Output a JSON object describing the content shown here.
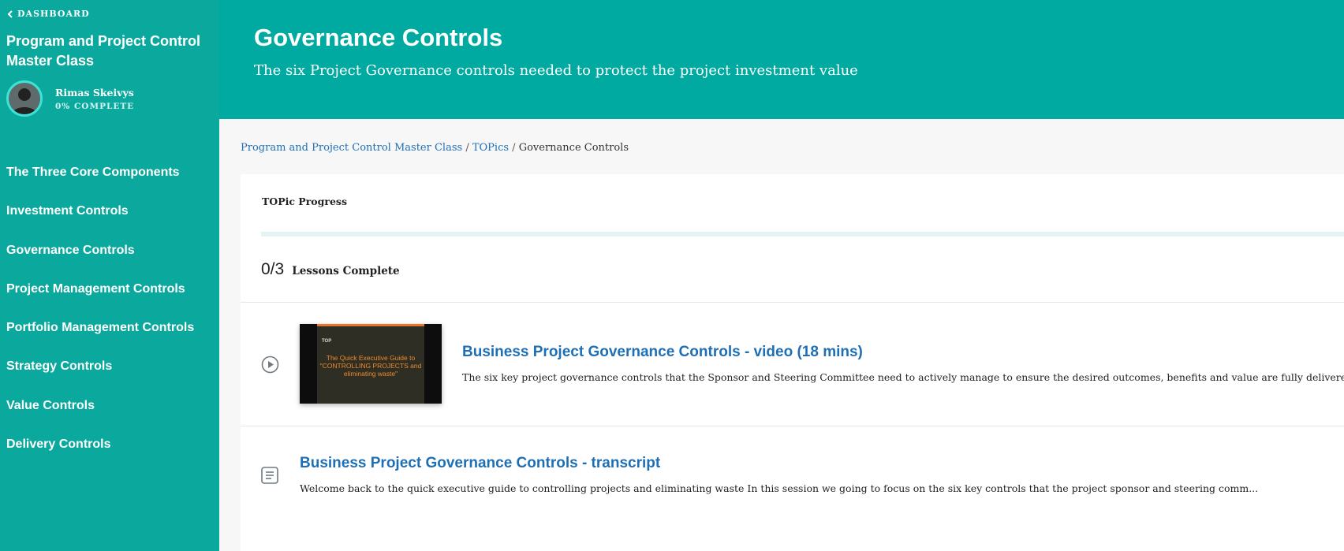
{
  "sidebar": {
    "back_label": "DASHBOARD",
    "course_title": "Program and Project Control Master Class",
    "user_name": "Rimas Skeivys",
    "progress_text": "0% COMPLETE",
    "items": [
      {
        "label": "The Three Core Components"
      },
      {
        "label": "Investment Controls"
      },
      {
        "label": "Governance Controls"
      },
      {
        "label": "Project Management Controls"
      },
      {
        "label": "Portfolio Management Controls"
      },
      {
        "label": "Strategy Controls"
      },
      {
        "label": "Value Controls"
      },
      {
        "label": "Delivery Controls"
      }
    ]
  },
  "header": {
    "title": "Governance Controls",
    "subtitle": "The six Project Governance controls needed to protect the project investment value"
  },
  "breadcrumb": {
    "course": "Program and Project Control Master Class",
    "topics": "TOPics",
    "current": "Governance Controls",
    "separator": "/"
  },
  "progress": {
    "label": "TOPic Progress",
    "fraction": 0,
    "count": "0/3",
    "lessons_label": "Lessons Complete"
  },
  "lessons": [
    {
      "icon": "play-circle-icon",
      "thumbnail_logo": "TOP",
      "thumbnail_text": "The Quick Executive Guide to \"CONTROLLING PROJECTS and eliminating waste\"",
      "title": "Business Project Governance Controls - video (18 mins)",
      "description": "The six key project governance controls that the Sponsor and Steering Committee need to actively manage to ensure the desired outcomes, benefits and value are fully delivered."
    },
    {
      "icon": "document-icon",
      "title": "Business Project Governance Controls - transcript",
      "description": "Welcome back to the quick executive guide to controlling projects and eliminating waste   In this session we going to focus on the six key controls that the project sponsor and steering comm..."
    }
  ],
  "colors": {
    "sidebar_bg": "#0ba89e",
    "header_bg": "#00aaa1",
    "link": "#1f6fb5",
    "thumbnail_accent": "#e9742b"
  }
}
